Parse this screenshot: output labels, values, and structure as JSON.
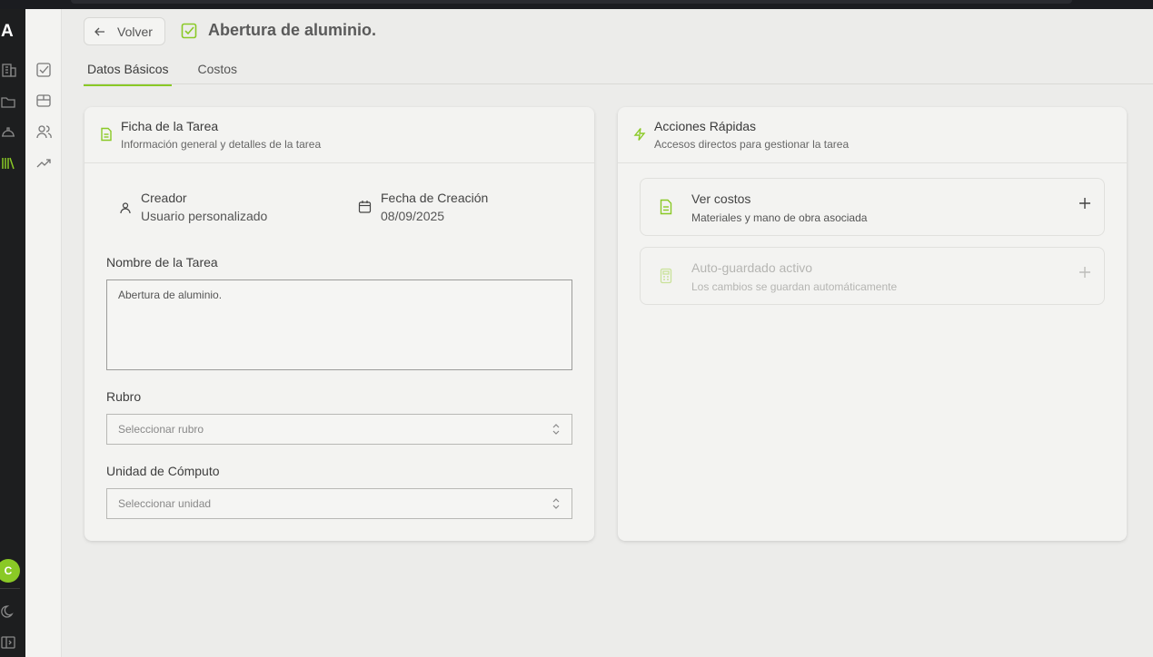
{
  "app": {
    "logo_letter": "A",
    "user_initial": "C"
  },
  "header": {
    "back_label": "Volver",
    "title": "Abertura de aluminio."
  },
  "tabs": [
    {
      "label": "Datos Básicos",
      "active": true
    },
    {
      "label": "Costos",
      "active": false
    }
  ],
  "ficha": {
    "title": "Ficha de la Tarea",
    "subtitle": "Información general y detalles de la tarea",
    "creator_label": "Creador",
    "creator_value": "Usuario personalizado",
    "date_label": "Fecha de Creación",
    "date_value": "08/09/2025",
    "name_label": "Nombre de la Tarea",
    "name_value": "Abertura de aluminio.",
    "rubro_label": "Rubro",
    "rubro_placeholder": "Seleccionar rubro",
    "unidad_label": "Unidad de Cómputo",
    "unidad_placeholder": "Seleccionar unidad"
  },
  "acciones": {
    "title": "Acciones Rápidas",
    "subtitle": "Accesos directos para gestionar la tarea",
    "items": [
      {
        "title": "Ver costos",
        "subtitle": "Materiales y mano de obra asociada",
        "icon": "file-text-icon"
      },
      {
        "title": "Auto-guardado activo",
        "subtitle": "Los cambios se guardan automáticamente",
        "icon": "calculator-icon"
      }
    ]
  },
  "colors": {
    "accent": "#8ac926",
    "rail_bg": "#1d1e1f",
    "page_bg": "#ececea",
    "card_bg": "#f3f3f1"
  }
}
